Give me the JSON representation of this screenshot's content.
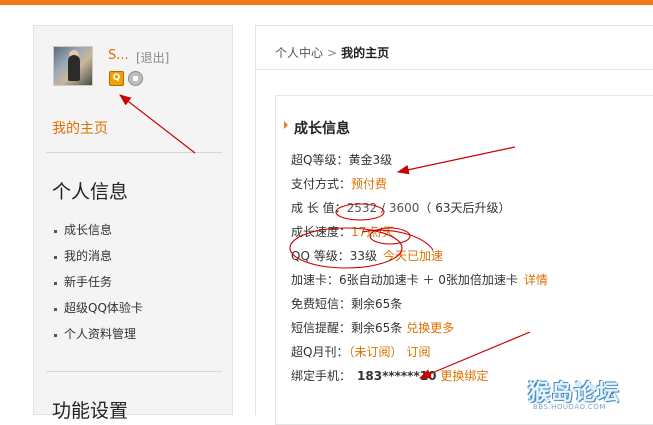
{
  "sidebar": {
    "username": "S...",
    "logout": "[退出]",
    "vip_badge": "Q",
    "home_link": "我的主页",
    "personal_title": "个人信息",
    "menu": [
      {
        "label": "成长信息"
      },
      {
        "label": "我的消息"
      },
      {
        "label": "新手任务"
      },
      {
        "label": "超级QQ体验卡"
      },
      {
        "label": "个人资料管理"
      }
    ],
    "function_title": "功能设置"
  },
  "main": {
    "breadcrumb": {
      "root": "个人中心",
      "sep": ">",
      "current": "我的主页"
    },
    "growth_title": "成长信息",
    "rows": {
      "level_label": "超Q等级：",
      "level_value": "黄金3级",
      "pay_label": "支付方式：",
      "pay_value": "预付费",
      "growth_label": "成 长 值：",
      "growth_current": "2532",
      "growth_sep": " / ",
      "growth_total": "3600",
      "growth_note": "（ 63天后升级）",
      "speed_label": "成长速度：",
      "speed_value": "17点/天",
      "qq_label": "QQ 等级：",
      "qq_value": "33级",
      "qq_accel": "今天已加速",
      "card_label": "加速卡：",
      "card_value": "6张自动加速卡 ＋ 0张加倍加速卡",
      "card_link": "详情",
      "sms_label": "免费短信：",
      "sms_value": "剩余65条",
      "remind_label": "短信提醒：",
      "remind_value": "剩余65条",
      "remind_link": "兑换更多",
      "mag_label": "超Q月刊：",
      "mag_status": "（未订阅）",
      "mag_link": "订阅",
      "phone_label": "绑定手机：",
      "phone_value": "183******10",
      "phone_link": "更换绑定"
    }
  },
  "watermark": {
    "text": "猴岛论坛",
    "sub": "BBS.HOUDAO.COM"
  },
  "colors": {
    "accent": "#f07a14",
    "link": "#e07000",
    "annotation": "#cc0000"
  }
}
